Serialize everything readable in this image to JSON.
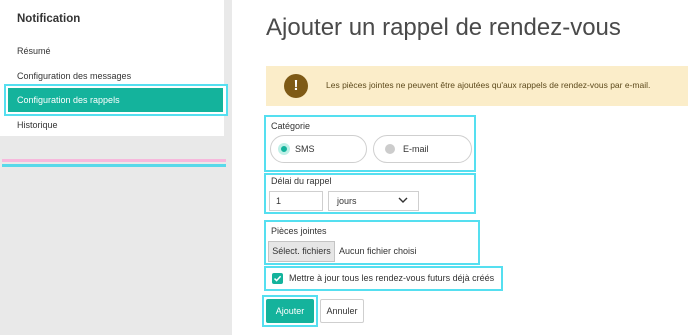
{
  "sidebar": {
    "title": "Notification",
    "items": [
      {
        "label": "Résumé"
      },
      {
        "label": "Configuration des messages"
      },
      {
        "label": "Configuration des rappels"
      },
      {
        "label": "Historique"
      }
    ]
  },
  "main": {
    "title": "Ajouter un rappel de rendez-vous",
    "notice": "Les pièces jointes ne peuvent être ajoutées qu'aux rappels de rendez-vous par e-mail.",
    "category": {
      "label": "Catégorie",
      "options": [
        {
          "label": "SMS",
          "selected": true
        },
        {
          "label": "E-mail",
          "selected": false
        }
      ]
    },
    "delay": {
      "label": "Délai du rappel",
      "value": "1",
      "unit": "jours"
    },
    "attachments": {
      "label": "Pièces jointes",
      "button_label": "Sélect. fichiers",
      "status": "Aucun fichier choisi"
    },
    "update_future": {
      "checked": true,
      "label": "Mettre à jour tous les rendez-vous futurs déjà créés"
    },
    "actions": {
      "add_label": "Ajouter",
      "cancel_label": "Annuler"
    }
  },
  "colors": {
    "accent": "#14b39c",
    "highlight_frame": "#55dff0",
    "notice_bg": "#fbedc9",
    "notice_icon": "#7e5a16"
  },
  "icons": {
    "notice": "warning-icon",
    "select": "chevron-down-icon",
    "checkbox": "checkmark-icon"
  }
}
